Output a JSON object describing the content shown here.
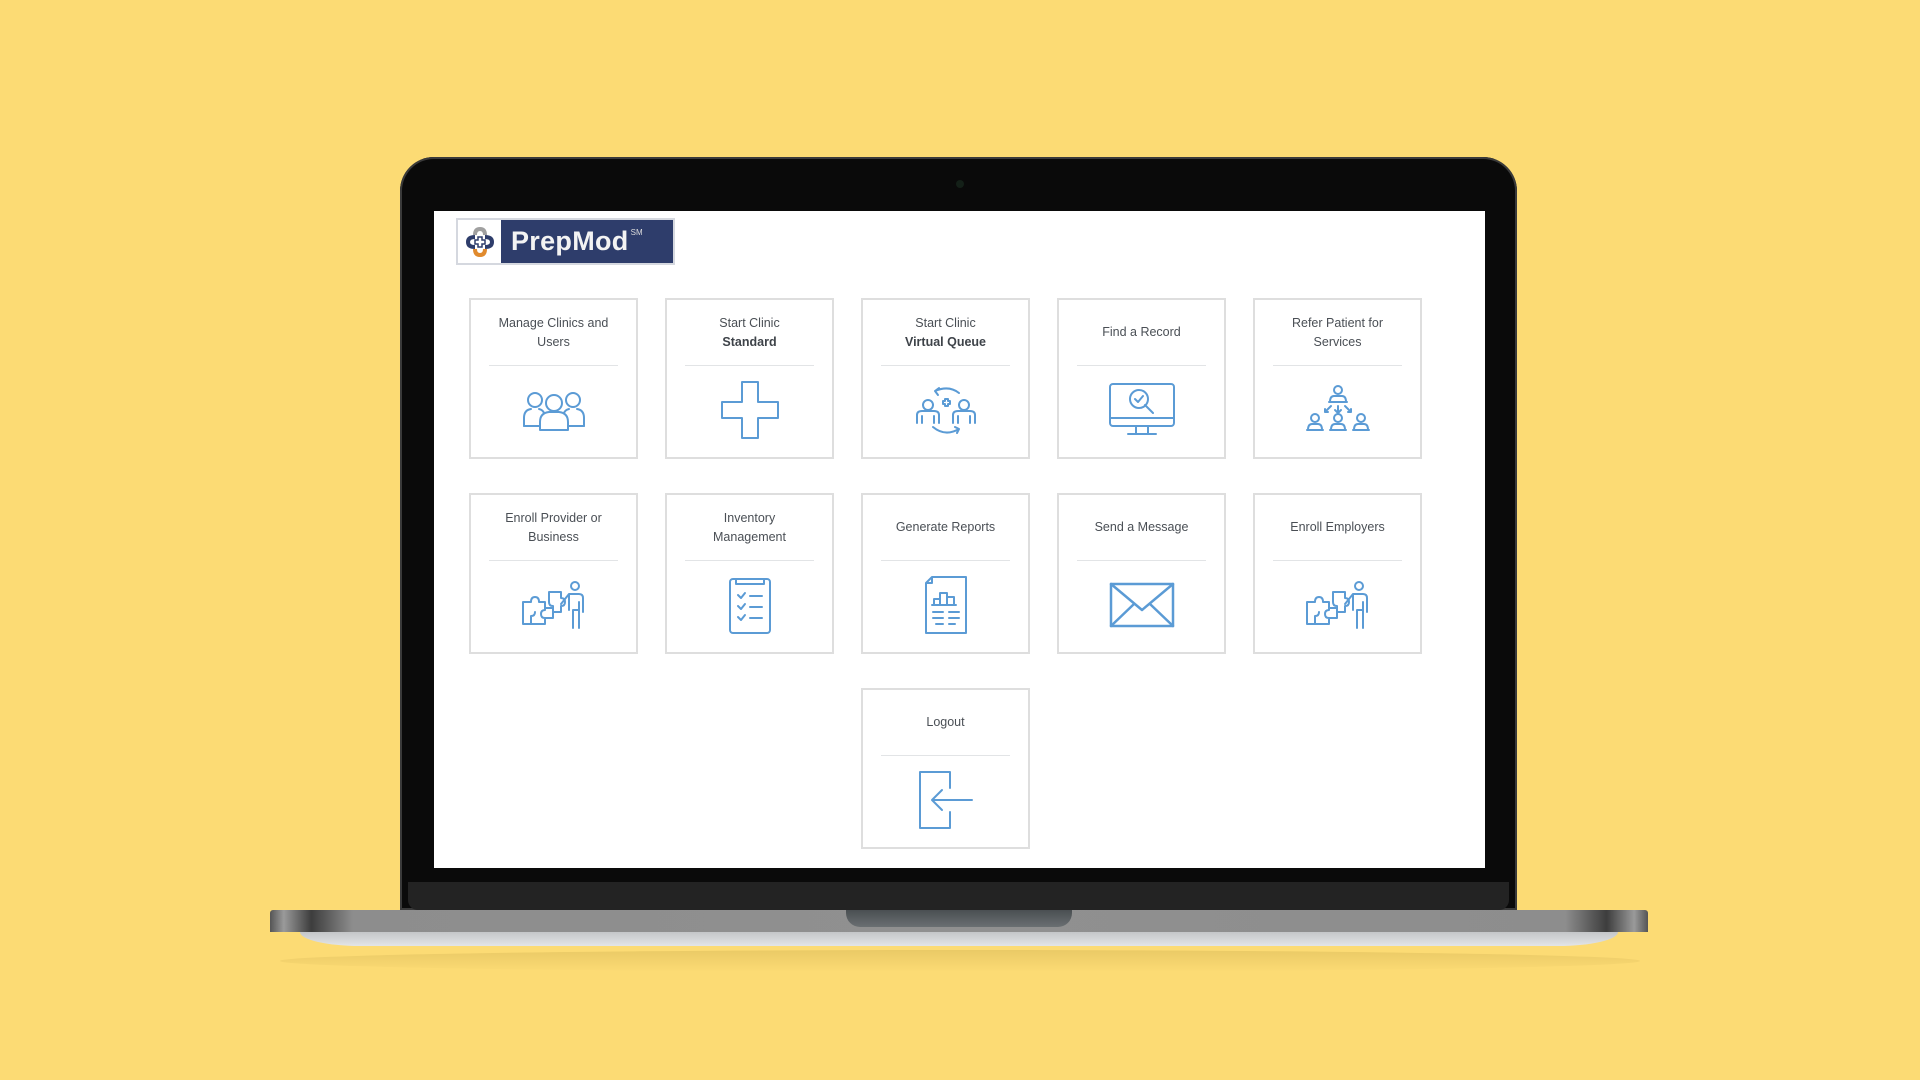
{
  "app": {
    "name": "PrepMod",
    "trademark": "SM",
    "brand_colors": {
      "navy": "#2e3d6b",
      "orange": "#e08a2e",
      "grey": "#a0a0a0",
      "icon_blue": "#5b9bd5"
    }
  },
  "tiles": [
    {
      "line1": "Manage Clinics and Users",
      "line2": "",
      "icon": "users-group-icon"
    },
    {
      "line1": "Start Clinic",
      "line2": "Standard",
      "icon": "medical-cross-icon"
    },
    {
      "line1": "Start Clinic",
      "line2": "Virtual Queue",
      "icon": "virtual-queue-icon"
    },
    {
      "line1": "Find a Record",
      "line2": "",
      "icon": "monitor-search-icon"
    },
    {
      "line1": "Refer Patient for Services",
      "line2": "",
      "icon": "referral-hierarchy-icon"
    },
    {
      "line1": "Enroll Provider or Business",
      "line2": "",
      "icon": "puzzle-person-icon"
    },
    {
      "line1": "Inventory Management",
      "line2": "",
      "icon": "clipboard-checklist-icon"
    },
    {
      "line1": "Generate Reports",
      "line2": "",
      "icon": "report-document-icon"
    },
    {
      "line1": "Send a Message",
      "line2": "",
      "icon": "envelope-icon"
    },
    {
      "line1": "Enroll Employers",
      "line2": "",
      "icon": "puzzle-person-icon"
    },
    {
      "line1": "Logout",
      "line2": "",
      "icon": "logout-door-icon"
    }
  ]
}
